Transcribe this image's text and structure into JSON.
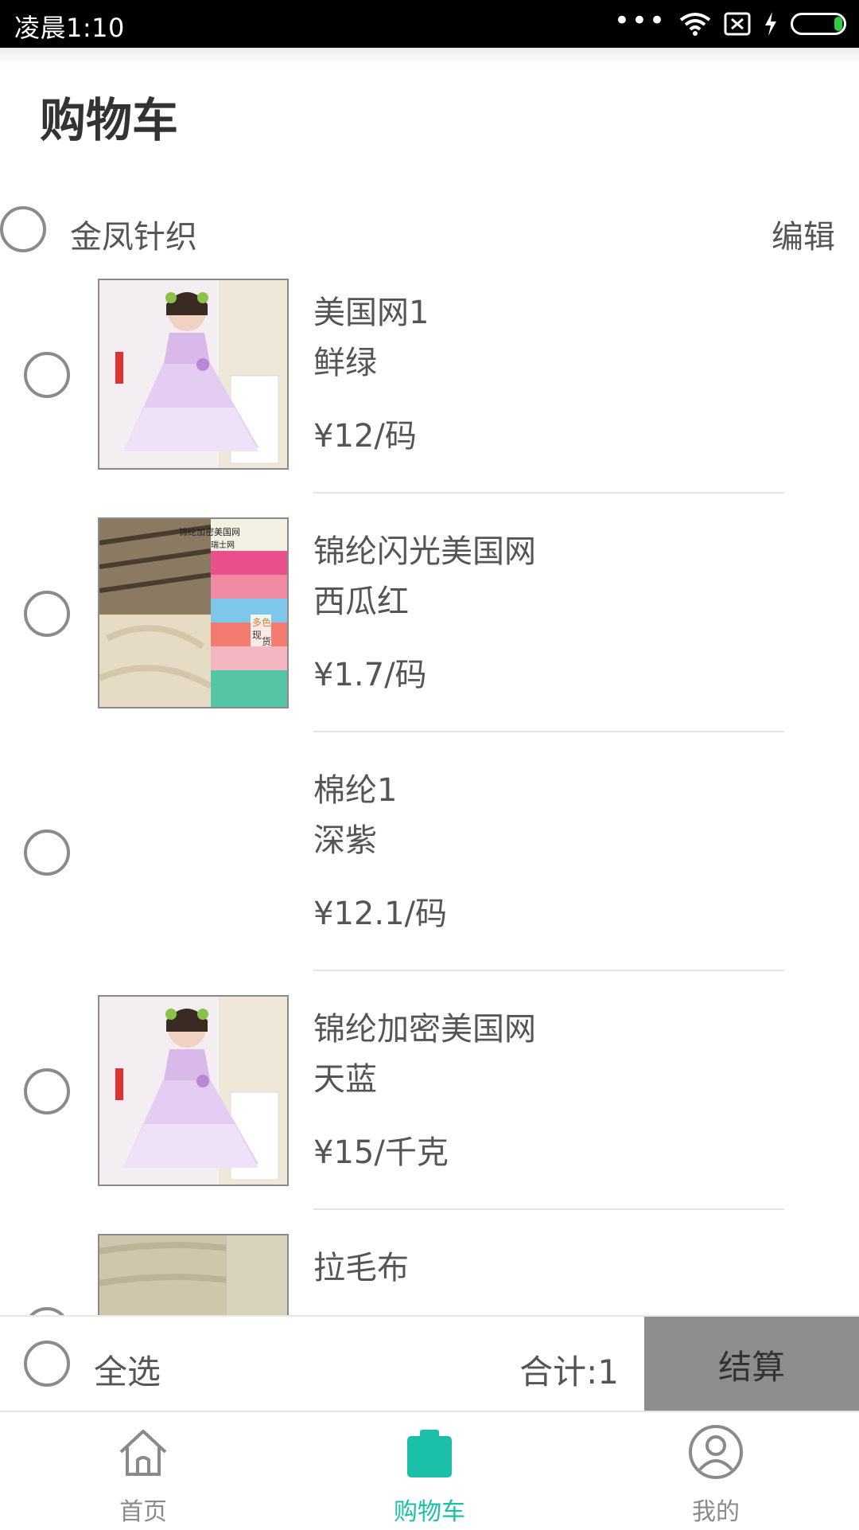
{
  "status_bar": {
    "time": "凌晨1:10",
    "dots": "•••"
  },
  "header": {
    "title": "购物车"
  },
  "shop": {
    "name": "金凤针织",
    "edit_label": "编辑"
  },
  "items": [
    {
      "name": "美国网1",
      "color": "鲜绿",
      "price": "¥12/码",
      "image": "girl-dress-photo"
    },
    {
      "name": "锦纶闪光美国网",
      "color": "西瓜红",
      "price": "¥1.7/码",
      "image": "mesh-fabric-collage"
    },
    {
      "name": "棉纶1",
      "color": "深紫",
      "price": "¥12.1/码",
      "image": ""
    },
    {
      "name": "锦纶加密美国网",
      "color": "天蓝",
      "price": "¥15/千克",
      "image": "girl-dress-photo"
    },
    {
      "name": "拉毛布",
      "color": "",
      "price": "",
      "image": "mesh-fabric-photo"
    }
  ],
  "collage_text": {
    "top": "锦纶加密美国网",
    "sub": "瑞士网",
    "badge1": "多色",
    "badge2": "现",
    "badge3": "货"
  },
  "summary": {
    "select_all": "全选",
    "total": "合计:1",
    "checkout": "结算"
  },
  "nav": {
    "items": [
      {
        "label": "首页",
        "icon": "home-icon"
      },
      {
        "label": "购物车",
        "icon": "cart-bag-icon",
        "active": true
      },
      {
        "label": "我的",
        "icon": "user-icon"
      }
    ]
  },
  "colors": {
    "accent": "#1bbfa8",
    "checkout_bg": "#8e8e8e"
  }
}
